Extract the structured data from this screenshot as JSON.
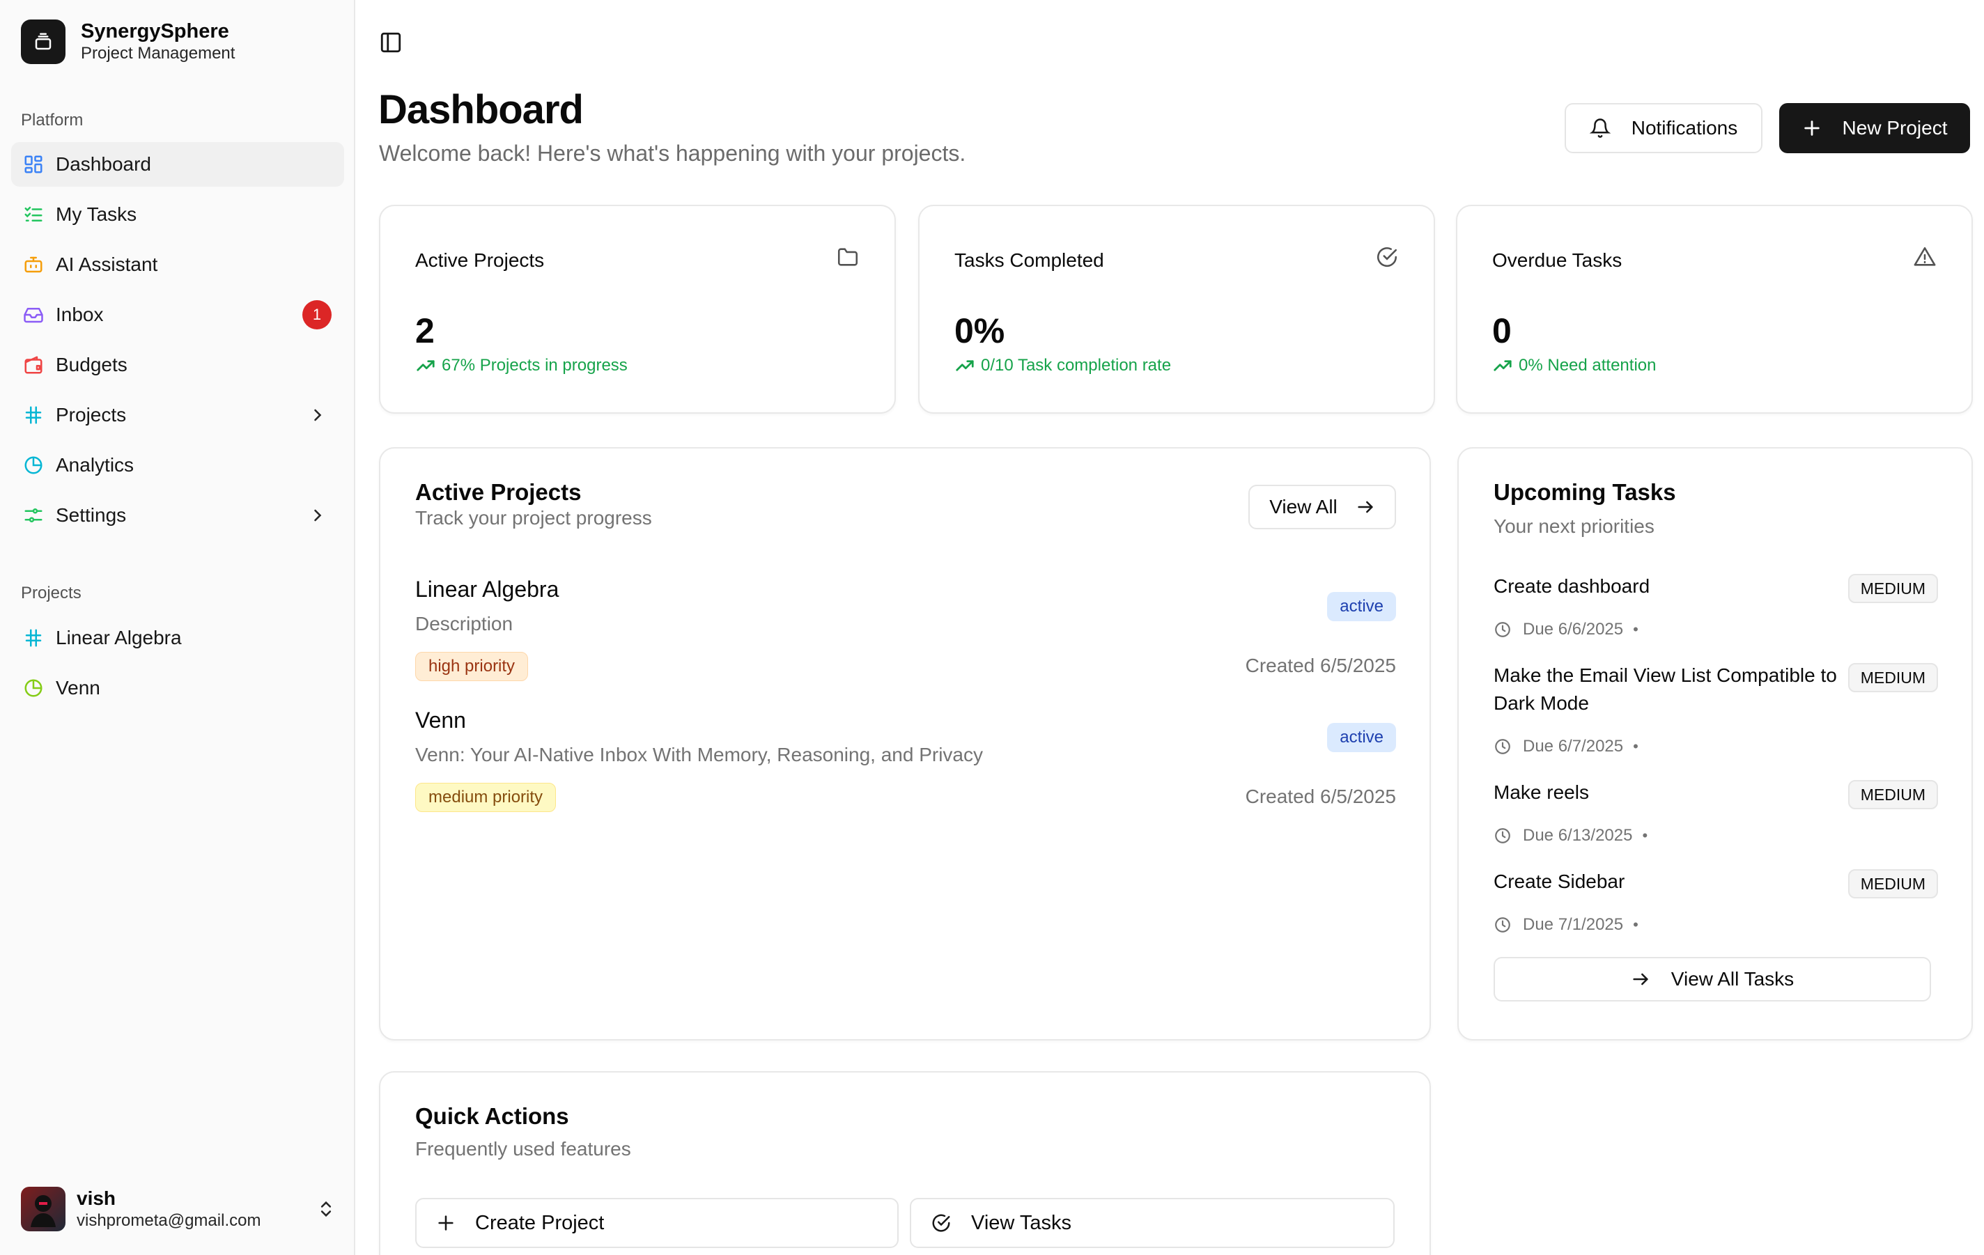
{
  "brand": {
    "name": "SynergySphere",
    "subtitle": "Project Management"
  },
  "sidebar": {
    "platform_label": "Platform",
    "items": [
      {
        "label": "Dashboard",
        "icon": "dashboard-grid-icon",
        "color": "#3b82f6"
      },
      {
        "label": "My Tasks",
        "icon": "task-list-icon",
        "color": "#22c55e"
      },
      {
        "label": "AI Assistant",
        "icon": "bot-icon",
        "color": "#f59e0b"
      },
      {
        "label": "Inbox",
        "icon": "inbox-icon",
        "color": "#8b5cf6",
        "badge": "1"
      },
      {
        "label": "Budgets",
        "icon": "wallet-icon",
        "color": "#ef4444"
      },
      {
        "label": "Projects",
        "icon": "hash-icon",
        "color": "#06b6d4"
      },
      {
        "label": "Analytics",
        "icon": "pie-chart-icon",
        "color": "#06b6d4"
      },
      {
        "label": "Settings",
        "icon": "settings-sliders-icon",
        "color": "#22c55e"
      }
    ],
    "projects_label": "Projects",
    "projects": [
      {
        "label": "Linear Algebra",
        "icon": "hash-icon",
        "color": "#06b6d4"
      },
      {
        "label": "Venn",
        "icon": "pie-chart-icon",
        "color": "#84cc16"
      }
    ]
  },
  "user": {
    "name": "vish",
    "email": "vishprometa@gmail.com"
  },
  "header": {
    "title": "Dashboard",
    "subtitle": "Welcome back! Here's what's happening with your projects.",
    "notifications_label": "Notifications",
    "new_project_label": "New Project"
  },
  "stats": [
    {
      "title": "Active Projects",
      "value": "2",
      "trend": "67% Projects in progress",
      "icon": "folder-icon"
    },
    {
      "title": "Tasks Completed",
      "value": "0%",
      "trend": "0/10 Task completion rate",
      "icon": "check-circle-icon"
    },
    {
      "title": "Overdue Tasks",
      "value": "0",
      "trend": "0% Need attention",
      "icon": "warning-triangle-icon"
    }
  ],
  "active_projects": {
    "title": "Active Projects",
    "subtitle": "Track your project progress",
    "view_all_label": "View All",
    "projects": [
      {
        "name": "Linear Algebra",
        "description": "Description",
        "status": "active",
        "priority": "high priority",
        "created": "Created 6/5/2025"
      },
      {
        "name": "Venn",
        "description": "Venn: Your AI-Native Inbox With Memory, Reasoning, and Privacy",
        "status": "active",
        "priority": "medium priority",
        "created": "Created 6/5/2025"
      }
    ]
  },
  "upcoming": {
    "title": "Upcoming Tasks",
    "subtitle": "Your next priorities",
    "tasks": [
      {
        "name": "Create dashboard",
        "priority": "MEDIUM",
        "due": "Due 6/6/2025",
        "sep": "•"
      },
      {
        "name": "Make the Email View List Compatible to Dark Mode",
        "priority": "MEDIUM",
        "due": "Due 6/7/2025",
        "sep": "•"
      },
      {
        "name": "Make reels",
        "priority": "MEDIUM",
        "due": "Due 6/13/2025",
        "sep": "•"
      },
      {
        "name": "Create Sidebar",
        "priority": "MEDIUM",
        "due": "Due 7/1/2025",
        "sep": "•"
      }
    ],
    "view_all_label": "View All Tasks"
  },
  "quick_actions": {
    "title": "Quick Actions",
    "subtitle": "Frequently used features",
    "create_label": "Create Project",
    "view_tasks_label": "View Tasks"
  }
}
